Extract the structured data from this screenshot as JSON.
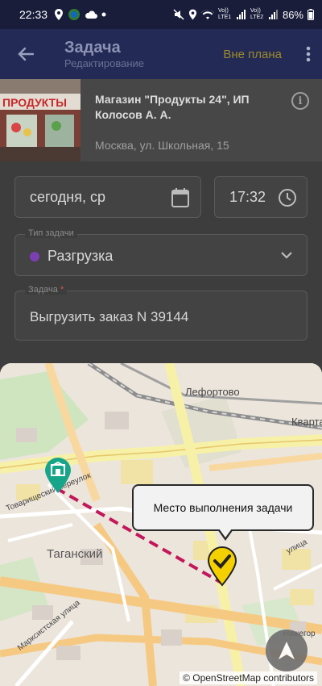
{
  "status_bar": {
    "time": "22:33",
    "sim1_label": "Vo)) LTE1",
    "sim2_label": "Vo)) LTE2",
    "battery": "86%"
  },
  "app_bar": {
    "title": "Задача",
    "subtitle": "Редактирование",
    "plan_badge": "Вне плана"
  },
  "shop": {
    "photo_sign": "ПРОДУКТЫ",
    "name": "Магазин \"Продукты 24\", ИП Колосов А. А.",
    "address": "Москва, ул. Школьная, 15"
  },
  "form": {
    "date_value": "сегодня, ср",
    "time_value": "17:32",
    "task_type_label": "Тип задачи",
    "task_type_value": "Разгрузка",
    "task_label": "Задача",
    "task_required_mark": "*",
    "task_value": "Выгрузить заказ N 39144"
  },
  "map": {
    "tooltip": "Место выполнения задачи",
    "attribution": "© OpenStreetMap contributors",
    "labels": {
      "lefortovo": "Лефортово",
      "kvartal": "Кварта",
      "taganskiy": "Таганский",
      "pereulok": "Товарищеский переулок",
      "ulitsa": "улица",
      "markistsky": "Марксистская улица",
      "nizhegor": "Нижегор"
    }
  },
  "colors": {
    "status_bar": "#191d3a",
    "app_bar": "#232a55",
    "route": "#c2185b",
    "shop_marker": "#17a589",
    "task_marker": "#f5d000",
    "task_type_dot": "#7b3fb3"
  }
}
